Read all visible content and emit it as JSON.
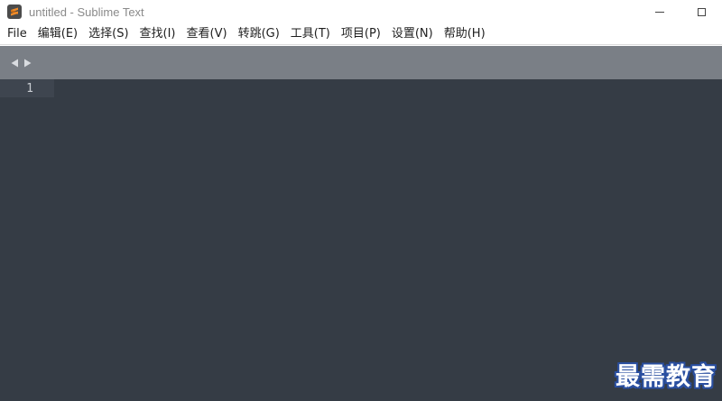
{
  "window": {
    "title": "untitled - Sublime Text",
    "app_icon": "sublime-text-icon"
  },
  "menubar": {
    "items": [
      {
        "label": "File"
      },
      {
        "label": "编辑(E)"
      },
      {
        "label": "选择(S)"
      },
      {
        "label": "查找(I)"
      },
      {
        "label": "查看(V)"
      },
      {
        "label": "转跳(G)"
      },
      {
        "label": "工具(T)"
      },
      {
        "label": "项目(P)"
      },
      {
        "label": "设置(N)"
      },
      {
        "label": "帮助(H)"
      }
    ]
  },
  "tabbar": {
    "nav_left_icon": "triangle-left-icon",
    "nav_right_icon": "triangle-right-icon"
  },
  "editor": {
    "lines": [
      {
        "number": "1",
        "text": ""
      }
    ]
  },
  "watermark": {
    "text": "最需教育"
  },
  "colors": {
    "editor_background": "#353c45",
    "tabbar_background": "#7a7f86",
    "current_line": "#3e454f",
    "icon_orange": "#f28c28",
    "watermark_blue": "#2a4fa0"
  }
}
